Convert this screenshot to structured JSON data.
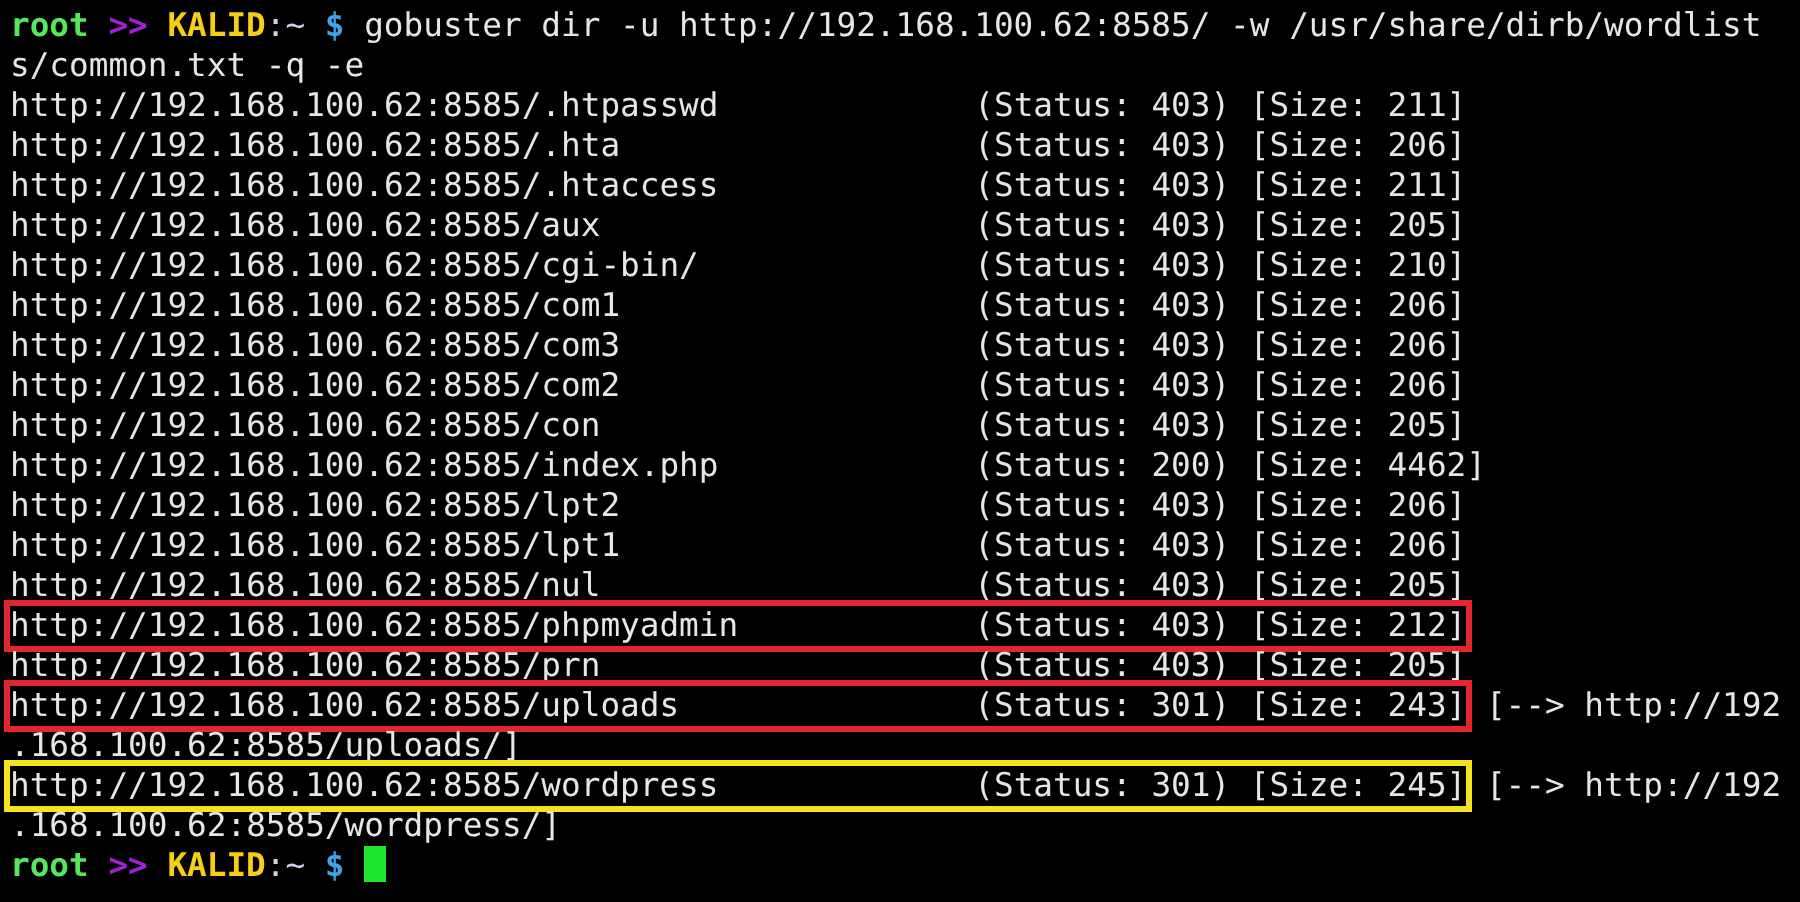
{
  "command_line": {
    "prompt": {
      "user": "root",
      "separator": ">>",
      "host": "KALID",
      "path": ":~",
      "symbol": "$"
    },
    "command_lines": [
      "gobuster dir -u http://192.168.100.62:8585/ -w /usr/share/dirb/wordlist",
      "s/common.txt -q -e"
    ]
  },
  "results": [
    {
      "url": "http://192.168.100.62:8585/.htpasswd",
      "status": "(Status: 403)",
      "size": "[Size: 211]"
    },
    {
      "url": "http://192.168.100.62:8585/.hta",
      "status": "(Status: 403)",
      "size": "[Size: 206]"
    },
    {
      "url": "http://192.168.100.62:8585/.htaccess",
      "status": "(Status: 403)",
      "size": "[Size: 211]"
    },
    {
      "url": "http://192.168.100.62:8585/aux",
      "status": "(Status: 403)",
      "size": "[Size: 205]"
    },
    {
      "url": "http://192.168.100.62:8585/cgi-bin/",
      "status": "(Status: 403)",
      "size": "[Size: 210]"
    },
    {
      "url": "http://192.168.100.62:8585/com1",
      "status": "(Status: 403)",
      "size": "[Size: 206]"
    },
    {
      "url": "http://192.168.100.62:8585/com3",
      "status": "(Status: 403)",
      "size": "[Size: 206]"
    },
    {
      "url": "http://192.168.100.62:8585/com2",
      "status": "(Status: 403)",
      "size": "[Size: 206]"
    },
    {
      "url": "http://192.168.100.62:8585/con",
      "status": "(Status: 403)",
      "size": "[Size: 205]"
    },
    {
      "url": "http://192.168.100.62:8585/index.php",
      "status": "(Status: 200)",
      "size": "[Size: 4462]"
    },
    {
      "url": "http://192.168.100.62:8585/lpt2",
      "status": "(Status: 403)",
      "size": "[Size: 206]"
    },
    {
      "url": "http://192.168.100.62:8585/lpt1",
      "status": "(Status: 403)",
      "size": "[Size: 206]"
    },
    {
      "url": "http://192.168.100.62:8585/nul",
      "status": "(Status: 403)",
      "size": "[Size: 205]"
    },
    {
      "url": "http://192.168.100.62:8585/phpmyadmin",
      "status": "(Status: 403)",
      "size": "[Size: 212]",
      "color": "#e3262d"
    },
    {
      "url": "http://192.168.100.62:8585/prn",
      "status": "(Status: 403)",
      "size": "[Size: 205]"
    },
    {
      "url": "http://192.168.100.62:8585/uploads",
      "status": "(Status: 301)",
      "size": "[Size: 243]",
      "color": "#e3262d",
      "redirect_lines": [
        "[--> http://192",
        ".168.100.62:8585/uploads/]"
      ]
    },
    {
      "url": "http://192.168.100.62:8585/wordpress",
      "status": "(Status: 301)",
      "size": "[Size: 245]",
      "color": "#f2e31b",
      "redirect_lines": [
        "[--> http://192",
        ".168.100.62:8585/wordpress/]"
      ]
    }
  ],
  "final_prompt": {
    "prompt": {
      "user": "root",
      "separator": ">>",
      "host": "KALID",
      "path": ":~",
      "symbol": "$"
    },
    "cursor": true
  }
}
